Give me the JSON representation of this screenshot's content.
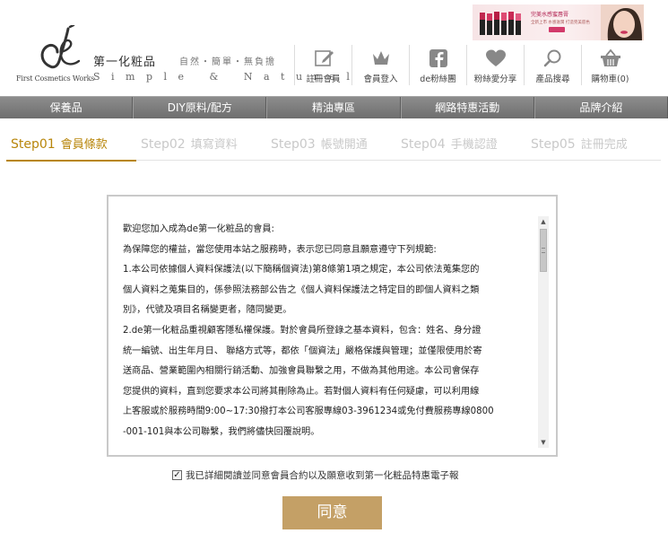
{
  "brand": {
    "logo_en": "First Cosmetics Works",
    "name_cn": "第一化粧品",
    "slogan": "自然・簡單・無負擔",
    "tagline_en": "Simple & Natural"
  },
  "banner": {
    "title": "完美水感蜜唇膏",
    "subtitle": "全新上市 水感滋潤 打造完美唇色"
  },
  "header_icons": [
    {
      "name": "register",
      "icon": "edit-icon",
      "label": "註冊會員"
    },
    {
      "name": "login",
      "icon": "crown-icon",
      "label": "會員登入"
    },
    {
      "name": "facebook",
      "icon": "facebook-icon",
      "label": "de粉絲團"
    },
    {
      "name": "share",
      "icon": "heart-icon",
      "label": "粉絲愛分享"
    },
    {
      "name": "search",
      "icon": "search-icon",
      "label": "產品搜尋"
    },
    {
      "name": "cart",
      "icon": "basket-icon",
      "label": "購物車(0)"
    }
  ],
  "nav": [
    "保養品",
    "DIY原料/配方",
    "精油專區",
    "網路特惠活動",
    "品牌介紹"
  ],
  "steps": [
    {
      "num": "Step01",
      "label": "會員條款",
      "active": true
    },
    {
      "num": "Step02",
      "label": "填寫資料",
      "active": false
    },
    {
      "num": "Step03",
      "label": "帳號開通",
      "active": false
    },
    {
      "num": "Step04",
      "label": "手機認證",
      "active": false
    },
    {
      "num": "Step05",
      "label": "註冊完成",
      "active": false
    }
  ],
  "terms": {
    "lines": [
      "歡迎您加入成為de第一化粧品的會員:",
      "為保障您的權益，當您使用本站之服務時，表示您已同意且願意遵守下列規範:",
      "1.本公司依據個人資料保護法(以下簡稱個資法)第8條第1項之規定，本公司依法蒐集您的",
      "個人資料之蒐集目的，係參照法務部公告之《個人資料保護法之特定目的即個人資料之類",
      "別》，代號及項目名稱變更者，隨同變更。",
      "2.de第一化粧品重視顧客隱私權保護。對於會員所登錄之基本資料，包含：姓名、身分證",
      "統一編號、出生年月日、 聯絡方式等，都依「個資法」嚴格保護與管理；並僅限使用於寄",
      "送商品、營業範圍內相關行銷活動、加強會員聯繫之用，不做為其他用途。本公司會保存",
      "您提供的資料，直到您要求本公司將其刪除為止。若對個人資料有任何疑慮，可以利用線",
      "上客服或於服務時間9:00~17:30撥打本公司客服專線03-3961234或免付費服務專線0800",
      "-001-101與本公司聯繫，我們將儘快回覆說明。"
    ]
  },
  "agree": {
    "checked": true,
    "label": "我已詳細閱讀並同意會員合約以及願意收到第一化粧品特惠電子報"
  },
  "submit": {
    "label": "同意"
  },
  "colors": {
    "accent": "#b8860b",
    "button": "#c4a066",
    "nav": "#7a7a7a"
  }
}
